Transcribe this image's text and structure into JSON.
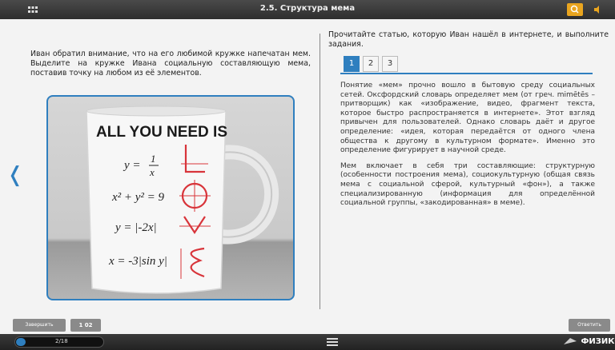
{
  "header": {
    "title": "2.5. Структура мема"
  },
  "left": {
    "instruction": "Иван обратил внимание, что на его любимой кружке напечатан мем. Выделите на кружке Ивана социальную составляющую мема, поставив точку на любом из её элементов."
  },
  "mug": {
    "headline": "ALL YOU NEED IS",
    "formulas": [
      "y = 1/x",
      "x² + y² = 9",
      "y = |-2x|",
      "x = -3|sin y|"
    ]
  },
  "right": {
    "intro": "Прочитайте статью, которую Иван нашёл в интернете, и выполните задания.",
    "tabs": [
      {
        "label": "1",
        "active": true
      },
      {
        "label": "2",
        "active": false
      },
      {
        "label": "3",
        "active": false
      }
    ],
    "paragraphs": [
      "Понятие «мем» прочно вошло в бытовую среду социальных сетей. Оксфордский словарь определяет мем (от греч. mimētēs – притворщик) как «изображение, видео, фрагмент текста, которое быстро распространяется в интернете». Этот взгляд привычен для пользователей. Однако словарь даёт и другое определение: «идея, которая передаётся от одного члена общества к другому в культурном формате». Именно это определение фигурирует в научной среде.",
      "Мем включает в себя три составляющие: структурную (особенности построения мема), социокультурную (общая связь мема с социальной сферой, культурный «фон»), а также специализированную (информация для определённой социальной группы, «закодированная» в меме)."
    ]
  },
  "footer": {
    "finish_label": "Завершить",
    "count_label": "1 02",
    "answer_label": "Ответить"
  },
  "bottom": {
    "progress_text": "2/18",
    "progress_fraction": 0.111,
    "brand": "ФИЗИКОН"
  },
  "colors": {
    "accent": "#2f7fbf",
    "search": "#e9a51f",
    "mug_red": "#d8343a"
  },
  "icons": [
    "grid-icon",
    "search-icon",
    "sound-icon",
    "prev-arrow-icon",
    "menu-icon",
    "brand-logo-icon"
  ]
}
